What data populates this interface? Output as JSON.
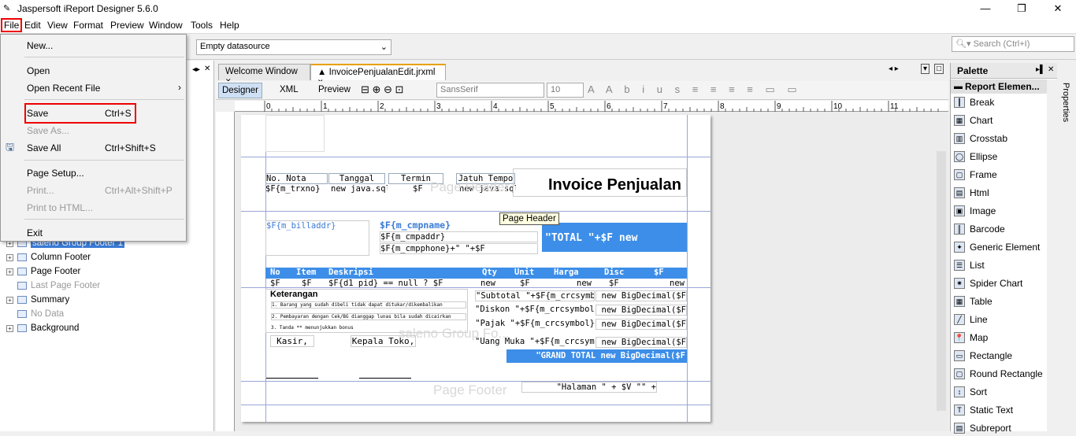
{
  "app": {
    "title": "Jaspersoft iReport Designer 5.6.0"
  },
  "menu": [
    "File",
    "Edit",
    "View",
    "Format",
    "Preview",
    "Window",
    "Tools",
    "Help"
  ],
  "toolbar": {
    "datasource": "Empty datasource",
    "search_placeholder": "Search (Ctrl+I)"
  },
  "file_menu": {
    "new": "New...",
    "open": "Open",
    "open_recent": "Open Recent File",
    "save": "Save",
    "save_sc": "Ctrl+S",
    "save_as": "Save As...",
    "save_all": "Save All",
    "save_all_sc": "Ctrl+Shift+S",
    "page_setup": "Page Setup...",
    "print": "Print...",
    "print_sc": "Ctrl+Alt+Shift+P",
    "print_html": "Print to HTML...",
    "exit": "Exit"
  },
  "tree": [
    "saleno Group Footer 1",
    "Column Footer",
    "Page Footer",
    "Last Page Footer",
    "Summary",
    "No Data",
    "Background"
  ],
  "tabs": [
    "Welcome Window",
    "InvoicePenjualanEdit.jrxml"
  ],
  "editor_tabs": [
    "Designer",
    "XML",
    "Preview"
  ],
  "font": {
    "name": "SansSerif",
    "size": "10"
  },
  "ruler": [
    "0",
    "1",
    "2",
    "3",
    "4",
    "5",
    "6",
    "7",
    "8",
    "9",
    "10",
    "11"
  ],
  "palette": {
    "title": "Palette",
    "group": "Report Elemen...",
    "items": [
      "Break",
      "Chart",
      "Crosstab",
      "Ellipse",
      "Frame",
      "Html",
      "Image",
      "Barcode",
      "Generic Element",
      "List",
      "Spider Chart",
      "Table",
      "Line",
      "Map",
      "Rectangle",
      "Round Rectangle",
      "Sort",
      "Static Text",
      "Subreport"
    ]
  },
  "properties_label": "Properties",
  "report": {
    "title": "Invoice Penjualan",
    "hdr": [
      "No. Nota",
      "Tanggal",
      "Termin",
      "Jatuh Tempo"
    ],
    "hdrv": [
      "$F{m_trxno}",
      "new java.sql.",
      "$F",
      "new java.sql."
    ],
    "billaddr": "$F{m_billaddr}",
    "cmpname": "$F{m_cmpname}",
    "cmpaddr": "$F{m_cmpaddr}",
    "cmpphone": "$F{m_cmpphone}+\" \"+$F",
    "total": "\"TOTAL \"+$F        new",
    "tooltip": "Page Header",
    "cols": [
      "No",
      "Item",
      "Deskripsi",
      "Qty",
      "Unit",
      "Harga",
      "Disc",
      "$F"
    ],
    "row": [
      "$F",
      "$F",
      "$F{d1_pid} == null ? $F",
      "new",
      "$F",
      "new",
      "$F",
      "new"
    ],
    "keterangan": "Keterangan",
    "notes": [
      "1. Barang yang sudah dibeli tidak dapat ditukar/dikembalikan",
      "2. Pembayaran dengan Cek/BG dianggap lunas bila sudah dicairkan",
      "3. Tanda ** menunjukkan bonus"
    ],
    "sums": [
      "\"Subtotal \"+$F{m_crcsymbol}",
      "\"Diskon \"+$F{m_crcsymbol}",
      "\"Pajak \"+$F{m_crcsymbol}",
      "\"Uang Muka \"+$F{m_crcsymbol}"
    ],
    "sumv": [
      "new BigDecimal($F",
      "new BigDecimal($F",
      "new BigDecimal($F",
      "new BigDecimal($F"
    ],
    "kasir": "Kasir,",
    "kepala": "Kepala Toko,",
    "grand": "\"GRAND TOTAL    new BigDecimal($F",
    "wm_header": "Page Header",
    "wm_group": "saleno Group Fo...",
    "wm_footer": "Page Footer",
    "halaman": "\"Halaman \" + $V  \"\" +"
  }
}
